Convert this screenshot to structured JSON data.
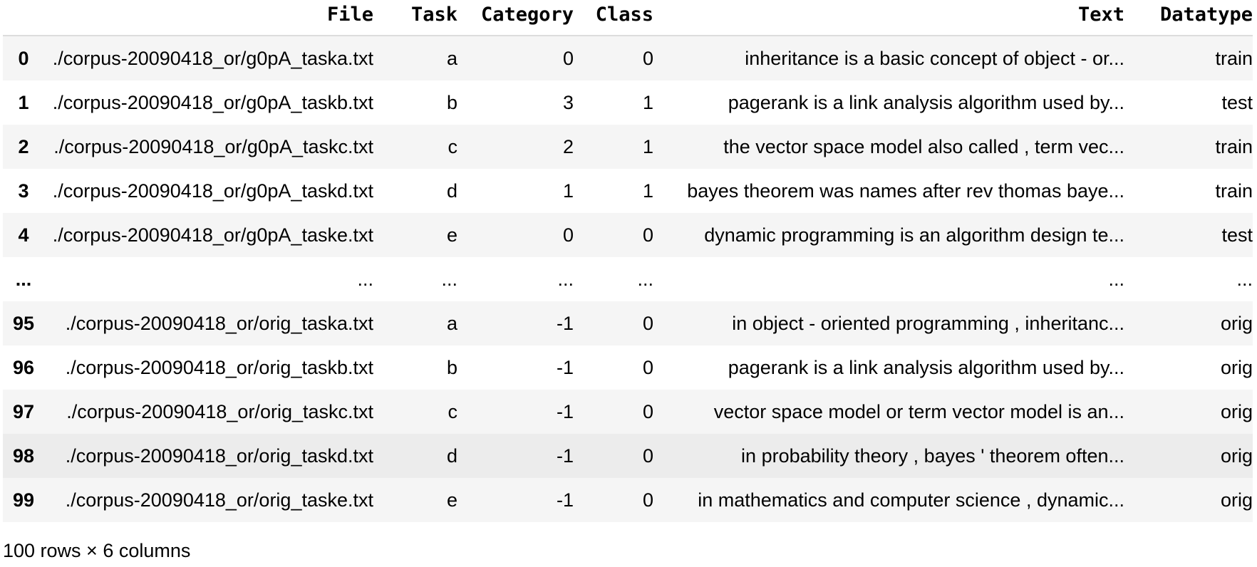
{
  "table": {
    "index_header": "",
    "columns": [
      "File",
      "Task",
      "Category",
      "Class",
      "Text",
      "Datatype"
    ],
    "rows": [
      {
        "index": "0",
        "cells": [
          "./corpus-20090418_or/g0pA_taska.txt",
          "a",
          "0",
          "0",
          "inheritance is a basic concept of object - or...",
          "train"
        ]
      },
      {
        "index": "1",
        "cells": [
          "./corpus-20090418_or/g0pA_taskb.txt",
          "b",
          "3",
          "1",
          "pagerank is a link analysis algorithm used by...",
          "test"
        ]
      },
      {
        "index": "2",
        "cells": [
          "./corpus-20090418_or/g0pA_taskc.txt",
          "c",
          "2",
          "1",
          "the vector space model also called , term vec...",
          "train"
        ]
      },
      {
        "index": "3",
        "cells": [
          "./corpus-20090418_or/g0pA_taskd.txt",
          "d",
          "1",
          "1",
          "bayes theorem was names after rev thomas baye...",
          "train"
        ]
      },
      {
        "index": "4",
        "cells": [
          "./corpus-20090418_or/g0pA_taske.txt",
          "e",
          "0",
          "0",
          "dynamic programming is an algorithm design te...",
          "test"
        ]
      },
      {
        "index": "...",
        "cells": [
          "...",
          "...",
          "...",
          "...",
          "...",
          "..."
        ]
      },
      {
        "index": "95",
        "cells": [
          "./corpus-20090418_or/orig_taska.txt",
          "a",
          "-1",
          "0",
          "in object - oriented programming , inheritanc...",
          "orig"
        ]
      },
      {
        "index": "96",
        "cells": [
          "./corpus-20090418_or/orig_taskb.txt",
          "b",
          "-1",
          "0",
          "pagerank is a link analysis algorithm used by...",
          "orig"
        ]
      },
      {
        "index": "97",
        "cells": [
          "./corpus-20090418_or/orig_taskc.txt",
          "c",
          "-1",
          "0",
          "vector space model or term vector model is an...",
          "orig"
        ]
      },
      {
        "index": "98",
        "cells": [
          "./corpus-20090418_or/orig_taskd.txt",
          "d",
          "-1",
          "0",
          "in probability theory , bayes ' theorem often...",
          "orig"
        ]
      },
      {
        "index": "99",
        "cells": [
          "./corpus-20090418_or/orig_taske.txt",
          "e",
          "-1",
          "0",
          "in mathematics and computer science , dynamic...",
          "orig"
        ]
      }
    ],
    "highlighted_row": 9
  },
  "footer": {
    "shape_text": "100 rows × 6 columns"
  },
  "colors": {
    "stripe": "#f5f5f5",
    "hover": "#ececec",
    "header_border": "#dcdcdc"
  }
}
